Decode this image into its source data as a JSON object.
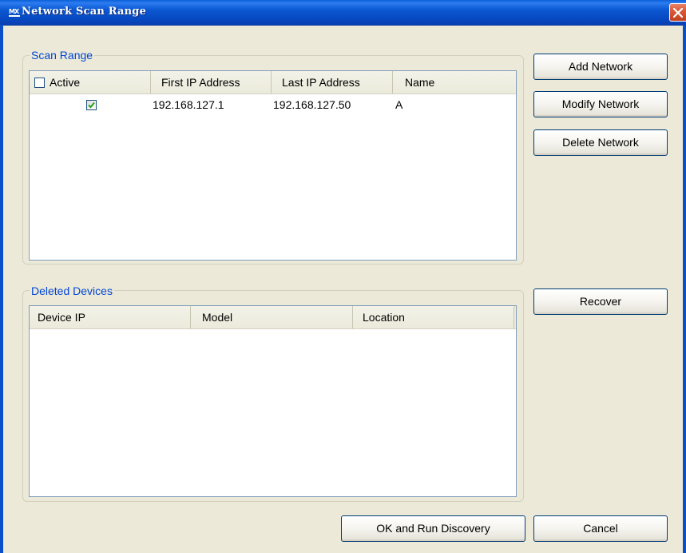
{
  "window": {
    "title": "Network Scan Range",
    "icon_text": "MX"
  },
  "scan_range": {
    "group_label": "Scan Range",
    "columns": {
      "active": "Active",
      "first_ip": "First IP Address",
      "last_ip": "Last IP Address",
      "name": "Name"
    },
    "rows": [
      {
        "active": true,
        "first_ip": "192.168.127.1",
        "last_ip": "192.168.127.50",
        "name": "A"
      }
    ]
  },
  "buttons": {
    "add_network": "Add Network",
    "modify_network": "Modify Network",
    "delete_network": "Delete Network",
    "recover": "Recover",
    "ok_run": "OK and Run Discovery",
    "cancel": "Cancel"
  },
  "deleted_devices": {
    "group_label": "Deleted Devices",
    "columns": {
      "device_ip": "Device IP",
      "model": "Model",
      "location": "Location"
    },
    "rows": []
  },
  "icons": {
    "title_icon": "mx-logo-icon",
    "close": "close-icon",
    "check": "checkmark-icon"
  },
  "colors": {
    "titlebar": "#0b58d2",
    "group_label": "#0046d5",
    "window_bg": "#ece9d8",
    "close_button": "#d95a3a",
    "checkmark": "#21a121"
  }
}
